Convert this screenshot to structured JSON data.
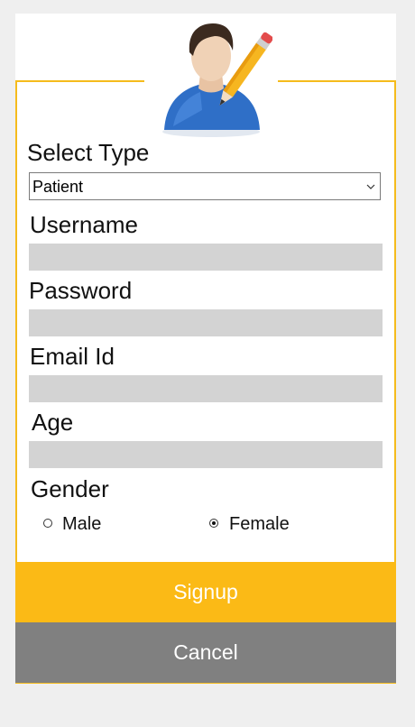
{
  "form": {
    "select_type_label": "Select Type",
    "select_type_value": "Patient",
    "username_label": "Username",
    "password_label": "Password",
    "email_label": "Email Id",
    "age_label": "Age",
    "gender_label": "Gender",
    "gender_options": [
      {
        "label": "Male",
        "selected": false
      },
      {
        "label": "Female",
        "selected": true
      }
    ]
  },
  "buttons": {
    "signup": "Signup",
    "cancel": "Cancel"
  },
  "colors": {
    "accent": "#fbba16",
    "border": "#f5bb1c",
    "cancel": "#808080",
    "field": "#d3d3d3"
  },
  "icons": {
    "avatar": "user-edit-icon",
    "dropdown": "chevron-down-icon"
  }
}
